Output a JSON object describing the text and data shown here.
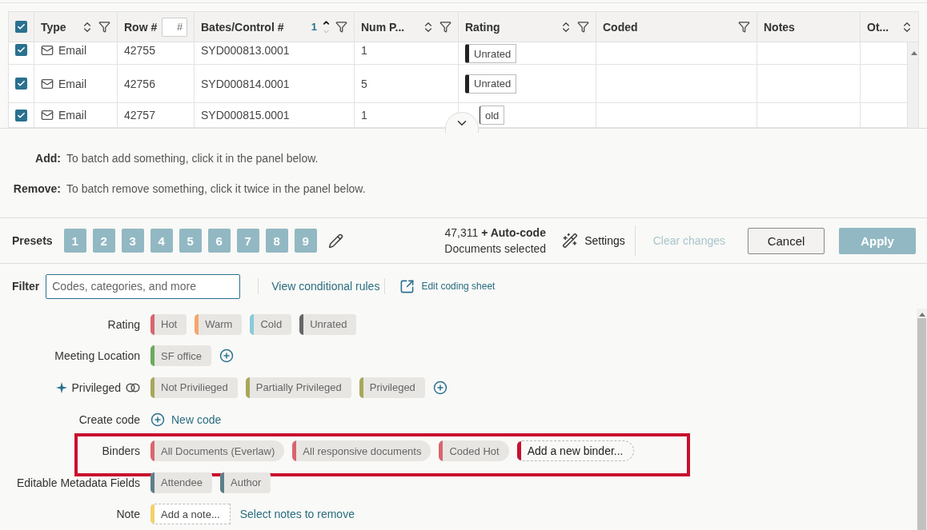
{
  "table": {
    "select_all_checked": true,
    "columns": [
      {
        "label": "Type",
        "sortable": true,
        "filter": true
      },
      {
        "label": "Row #",
        "field_placeholder": "#"
      },
      {
        "label": "Bates/Control #",
        "sortable": true,
        "sorted": true,
        "sort_order": "1",
        "filter": true
      },
      {
        "label": "Num P...",
        "sortable": true,
        "filter": true
      },
      {
        "label": "Rating",
        "sortable": true,
        "filter": true
      },
      {
        "label": "Coded",
        "filter": true
      },
      {
        "label": "Notes"
      },
      {
        "label": "Ot...",
        "sortable": true
      }
    ],
    "rows": [
      {
        "checked": true,
        "type": "Email",
        "row": "42755",
        "bates": "SYD000813.0001",
        "pages": "1",
        "rating": "Unrated"
      },
      {
        "checked": true,
        "type": "Email",
        "row": "42756",
        "bates": "SYD000814.0001",
        "pages": "5",
        "rating": "Unrated"
      },
      {
        "checked": true,
        "type": "Email",
        "row": "42757",
        "bates": "SYD000815.0001",
        "pages": "1",
        "rating": "old"
      }
    ]
  },
  "batch": [
    {
      "label": "Add:",
      "text": "To batch add something, click it in the panel below."
    },
    {
      "label": "Remove:",
      "text": "To batch remove something, click it twice in the panel below."
    }
  ],
  "presets": {
    "label": "Presets",
    "buttons": [
      "1",
      "2",
      "3",
      "4",
      "5",
      "6",
      "7",
      "8",
      "9"
    ]
  },
  "selection": {
    "line": "47,311 **+ Auto-code**",
    "caption": "Documents selected"
  },
  "actions": {
    "settings": "Settings",
    "clear": {
      "label": "Clear changes",
      "disabled": true
    },
    "cancel": "Cancel",
    "apply": "Apply"
  },
  "filter": {
    "label": "Filter",
    "placeholder": "Codes, categories, and more",
    "links": [
      "View conditional rules",
      "Edit coding sheet"
    ]
  },
  "categories": [
    {
      "label": "Rating",
      "kind": "tags",
      "tags": [
        {
          "label": "Hot",
          "color": "#d9646e"
        },
        {
          "label": "Warm",
          "color": "#f4a66c"
        },
        {
          "label": "Cold",
          "color": "#8ccad9"
        },
        {
          "label": "Unrated",
          "color": "#666666"
        }
      ]
    },
    {
      "label": "Meeting Location",
      "kind": "tags",
      "add": true,
      "tags": [
        {
          "label": "SF office",
          "color": "#6aaa5e"
        }
      ]
    },
    {
      "label": "Privileged",
      "kind": "tags",
      "starred": true,
      "exclusive": true,
      "add": true,
      "tags": [
        {
          "label": "Not Privilieged",
          "color": "#a8a85a"
        },
        {
          "label": "Partially Privileged",
          "color": "#a8a85a"
        },
        {
          "label": "Privileged",
          "color": "#a8a85a"
        }
      ]
    },
    {
      "label": "Create code",
      "kind": "create",
      "link": "New code"
    },
    {
      "label": "Binders",
      "kind": "binders",
      "highlighted": true,
      "tags": [
        {
          "label": "All Documents (Everlaw)",
          "color": "#d9646e",
          "kind": "tag"
        },
        {
          "label": "All responsive documents",
          "color": "#d9646e",
          "kind": "tag"
        },
        {
          "label": "Coded Hot",
          "color": "#d9646e",
          "kind": "tag"
        },
        {
          "label": "Add a new binder...",
          "color": "#c8102e",
          "kind": "new"
        }
      ]
    },
    {
      "label": "Editable Metadata Fields",
      "kind": "tags",
      "tags": [
        {
          "label": "Attendee",
          "color": "#5d7f8a"
        },
        {
          "label": "Author",
          "color": "#5d7f8a"
        }
      ]
    },
    {
      "label": "Note",
      "kind": "note",
      "tags": [
        {
          "label": "Add a note...",
          "color": "#f2d16b"
        }
      ],
      "link": "Select notes to remove"
    }
  ]
}
